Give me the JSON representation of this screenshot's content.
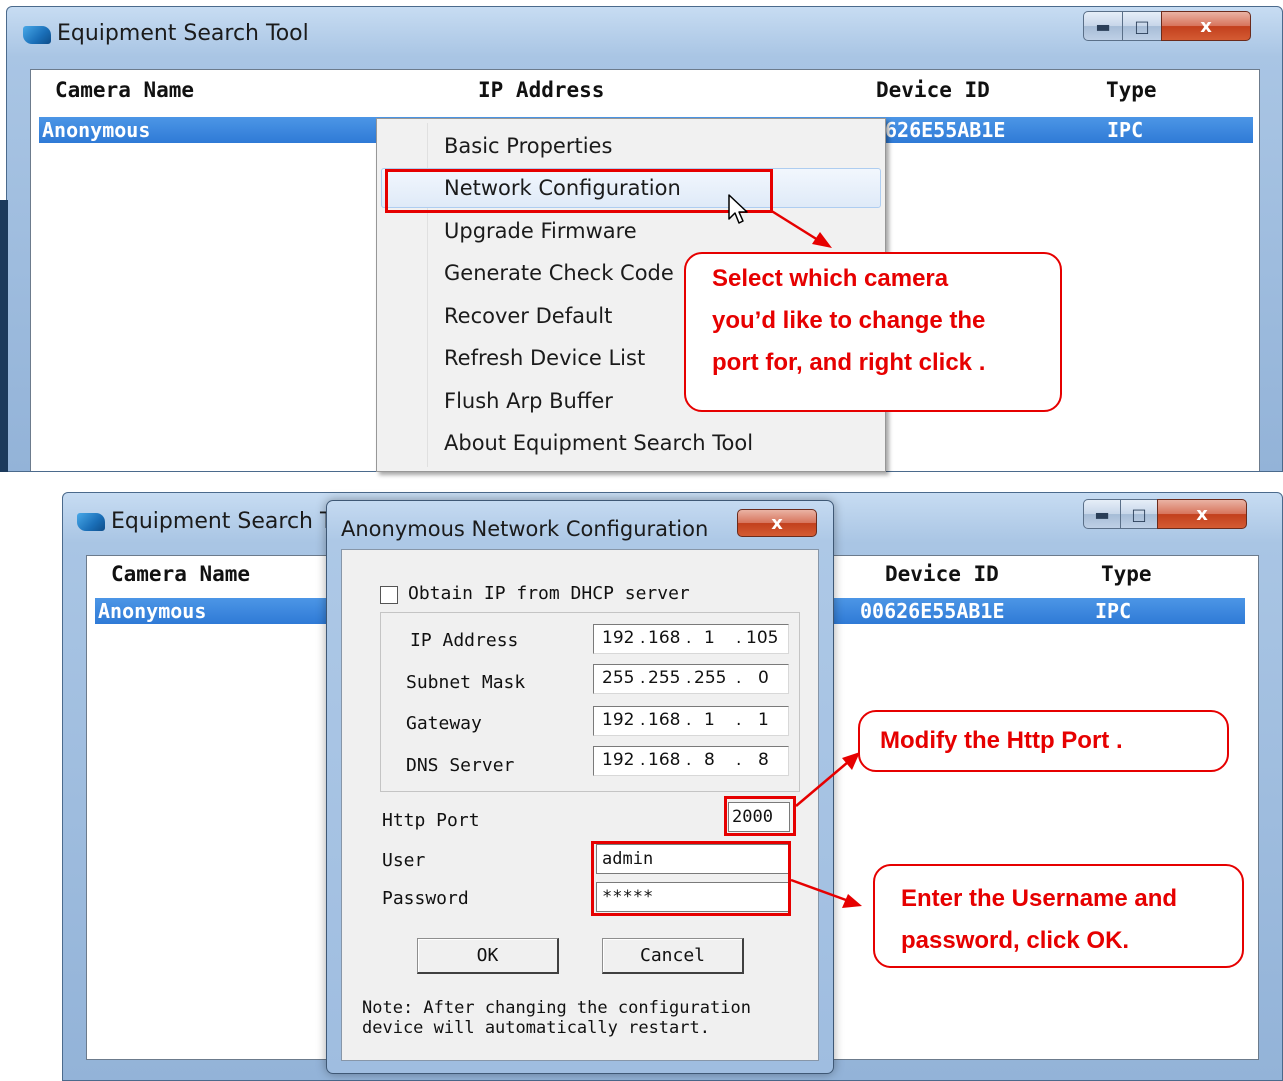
{
  "top_window": {
    "title": "Equipment Search Tool",
    "columns": [
      "Camera Name",
      "IP Address",
      "Device ID",
      "Type"
    ],
    "row": {
      "camera_name": "Anonymous",
      "device_id": "626E55AB1E",
      "type": "IPC"
    },
    "controls": {
      "minimize": "▬",
      "maximize": "□",
      "close": "x"
    }
  },
  "context_menu": {
    "items": [
      "Basic Properties",
      "Network Configuration",
      "Upgrade Firmware",
      "Generate Check Code",
      "Recover Default",
      "Refresh Device List",
      "Flush Arp Buffer",
      "About Equipment Search Tool"
    ],
    "highlighted": "Network Configuration"
  },
  "callouts": {
    "select": [
      "Select which camera",
      "you’d like to change the",
      "port for, and right click ."
    ],
    "http_port": [
      "Modify the Http Port ."
    ],
    "credentials": [
      "Enter the Username and",
      "password, click OK."
    ]
  },
  "bottom_window": {
    "title": "Equipment Search To",
    "columns": [
      "Camera Name",
      "Device ID",
      "Type"
    ],
    "row": {
      "camera_name": "Anonymous",
      "device_id": "00626E55AB1E",
      "type": "IPC"
    },
    "controls": {
      "minimize": "▬",
      "maximize": "□",
      "close": "x"
    }
  },
  "dialog": {
    "title": "Anonymous Network Configuration",
    "close": "x",
    "dhcp_label": "Obtain IP from DHCP server",
    "fields": {
      "ip_address": {
        "label": "IP Address",
        "octets": [
          "192",
          "168",
          "1",
          "105"
        ]
      },
      "subnet_mask": {
        "label": "Subnet Mask",
        "octets": [
          "255",
          "255",
          "255",
          "0"
        ]
      },
      "gateway": {
        "label": "Gateway",
        "octets": [
          "192",
          "168",
          "1",
          "1"
        ]
      },
      "dns_server": {
        "label": "DNS Server",
        "octets": [
          "192",
          "168",
          "8",
          "8"
        ]
      }
    },
    "http_port": {
      "label": "Http Port",
      "value": "2000"
    },
    "user": {
      "label": "User",
      "value": "admin"
    },
    "password": {
      "label": "Password",
      "value": "*****"
    },
    "ok": "OK",
    "cancel": "Cancel",
    "note_line1": "Note: After changing the configuration",
    "note_line2": "device will automatically restart."
  },
  "colors": {
    "accent_red": "#e60000",
    "selection_blue": "#3383dd"
  }
}
